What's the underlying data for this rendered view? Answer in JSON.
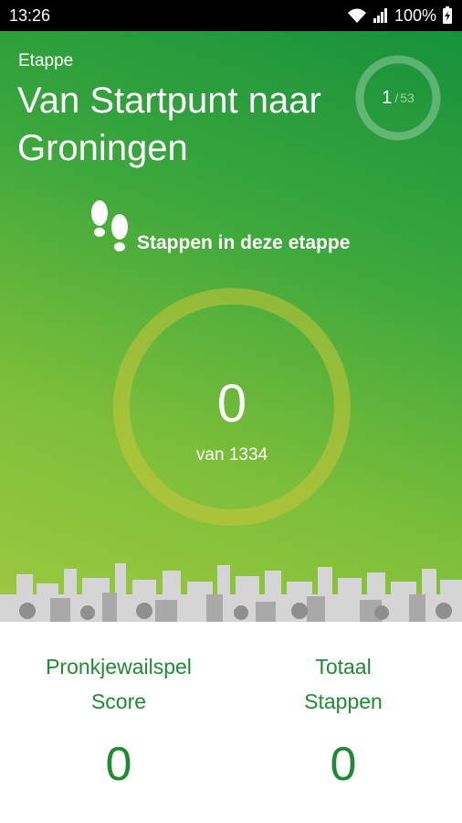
{
  "status_bar": {
    "time": "13:26",
    "battery": "100%",
    "icons": [
      "wifi-icon",
      "signal-icon",
      "battery-icon"
    ]
  },
  "stage": {
    "label": "Etappe",
    "title": "Van Startpunt naar Groningen",
    "progress": {
      "current": "1",
      "separator": "/",
      "total": "53"
    }
  },
  "steps": {
    "label": "Stappen in deze etappe",
    "count": "0",
    "total_text": "van 1334"
  },
  "stats": {
    "score": {
      "label_line1": "Pronkjewailspel",
      "label_line2": "Score",
      "value": "0"
    },
    "total_steps": {
      "label_line1": "Totaal",
      "label_line2": "Stappen",
      "value": "0"
    }
  },
  "colors": {
    "accent_green": "#1f8a33",
    "gradient_top": "#17913c",
    "gradient_bottom": "#9ec93f",
    "ring_color": "#c9c43a"
  }
}
